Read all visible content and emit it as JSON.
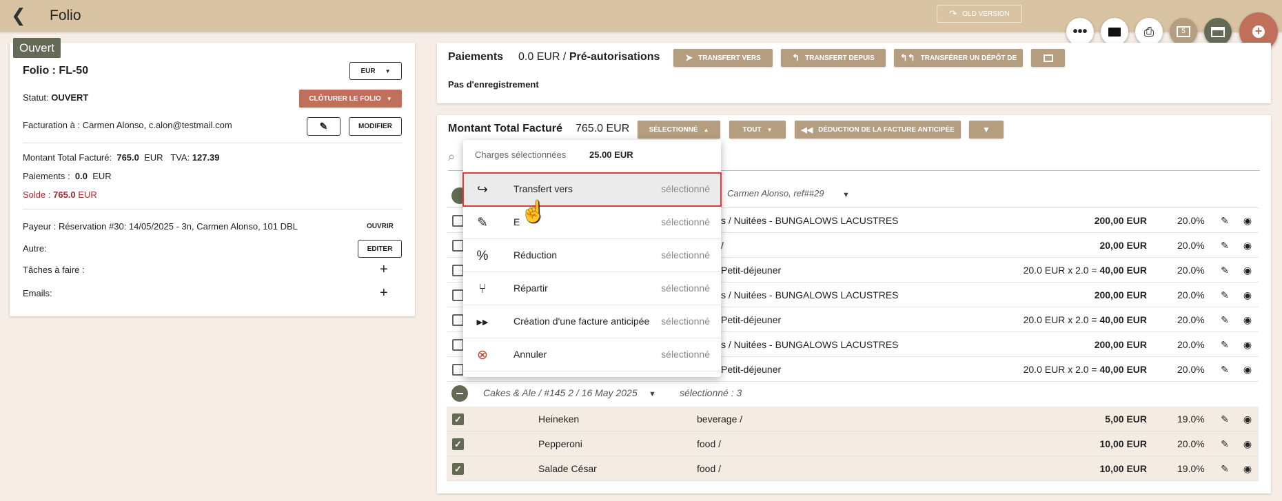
{
  "header": {
    "title": "Folio",
    "old_version": "OLD VERSION"
  },
  "status_tag": "Ouvert",
  "folio": {
    "title": "Folio : FL-50",
    "currency": "EUR",
    "status_label": "Statut:",
    "status_value": "OUVERT",
    "close_btn": "CLÔTURER LE FOLIO",
    "billing": "Facturation à : Carmen Alonso, c.alon@testmail.com",
    "modify_btn": "MODIFIER",
    "total_label": "Montant Total Facturé:",
    "total_value": "765.0",
    "total_cur": "EUR",
    "tva_label": "TVA:",
    "tva_value": "127.39",
    "pay_label": "Paiements :",
    "pay_value": "0.0",
    "pay_cur": "EUR",
    "solde_label": "Solde :",
    "solde_value": "765.0",
    "solde_cur": "EUR",
    "payer": "Payeur : Réservation #30: 14/05/2025 - 3n, Carmen Alonso, 101 DBL",
    "open_btn": "OUVRIR",
    "other_label": "Autre:",
    "edit_btn": "EDITER",
    "tasks_label": "Tâches à faire :",
    "emails_label": "Emails:"
  },
  "payments": {
    "title": "Paiements",
    "amount": "0.0 EUR /",
    "preauth": "Pré-autorisations",
    "btn_transfer_to": "TRANSFERT VERS",
    "btn_transfer_from": "TRANSFERT DEPUIS",
    "btn_transfer_deposit": "TRANSFÉRER UN DÉPÔT DE",
    "empty": "Pas d'enregistrement"
  },
  "charges": {
    "title": "Montant Total Facturé",
    "amount": "765.0 EUR",
    "btn_selected": "SÉLECTIONNÉ",
    "btn_all": "TOUT",
    "btn_advance": "DÉDUCTION DE LA FACTURE ANTICIPÉE",
    "group1_label": "Carmen Alonso, ref##29",
    "rows": [
      {
        "desc": "s / Nuitées - BUNGALOWS LACUSTRES",
        "calc": "",
        "amount": "200,00 EUR",
        "tax": "20.0%"
      },
      {
        "desc": "/",
        "calc": "",
        "amount": "20,00 EUR",
        "tax": "20.0%"
      },
      {
        "desc": "Petit-déjeuner",
        "calc": "20.0 EUR x 2.0 =",
        "amount": "40,00 EUR",
        "tax": "20.0%"
      },
      {
        "desc": "s / Nuitées - BUNGALOWS LACUSTRES",
        "calc": "",
        "amount": "200,00 EUR",
        "tax": "20.0%"
      },
      {
        "desc": "Petit-déjeuner",
        "calc": "20.0 EUR x 2.0 =",
        "amount": "40,00 EUR",
        "tax": "20.0%"
      },
      {
        "desc": "s / Nuitées - BUNGALOWS LACUSTRES",
        "calc": "",
        "amount": "200,00 EUR",
        "tax": "20.0%"
      },
      {
        "desc": "Petit-déjeuner",
        "calc": "20.0 EUR x 2.0 =",
        "amount": "40,00 EUR",
        "tax": "20.0%"
      }
    ],
    "group2_label": "Cakes & Ale / #145 2 / 16 May 2025",
    "group2_selected": "sélectionné : 3",
    "rows2": [
      {
        "name": "Heineken",
        "cat": "beverage /",
        "amount": "5,00 EUR",
        "tax": "19.0%"
      },
      {
        "name": "Pepperoni",
        "cat": "food /",
        "amount": "10,00 EUR",
        "tax": "20.0%"
      },
      {
        "name": "Salade César",
        "cat": "food /",
        "amount": "10,00 EUR",
        "tax": "19.0%"
      }
    ]
  },
  "menu": {
    "header_label": "Charges sélectionnées",
    "header_amount": "25.00 EUR",
    "items": [
      {
        "icon": "transfer-icon",
        "label": "Transfert vers",
        "status": "sélectionné"
      },
      {
        "icon": "pencil-icon",
        "label": "E",
        "status": "sélectionné"
      },
      {
        "icon": "percent-icon",
        "label": "Réduction",
        "status": "sélectionné"
      },
      {
        "icon": "split-icon",
        "label": "Répartir",
        "status": "sélectionné"
      },
      {
        "icon": "fast-forward-icon",
        "label": "Création d'une facture anticipée",
        "status": "sélectionné"
      },
      {
        "icon": "cancel-icon",
        "label": "Annuler",
        "status": "sélectionné"
      }
    ]
  },
  "fab": {
    "badge": "5"
  },
  "colors": {
    "header": "#d8c4a3",
    "accent_btn": "#b59e80",
    "danger_btn": "#c0705a",
    "tag": "#636a55",
    "fab_add": "#c0705a",
    "solde": "#a52a2a",
    "highlight_outline": "#e53935"
  }
}
